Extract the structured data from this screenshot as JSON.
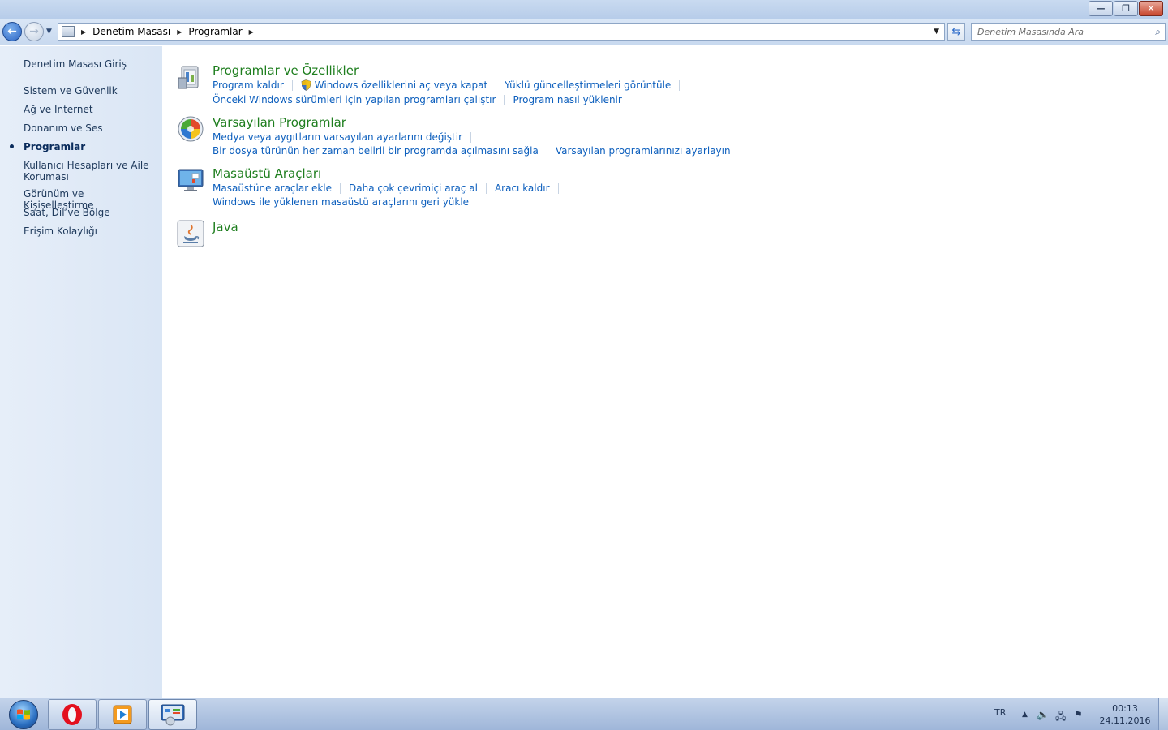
{
  "window": {
    "controls": {
      "minimize": "—",
      "restore": "❐",
      "close": "✕"
    }
  },
  "address": {
    "crumbs": [
      "Denetim Masası",
      "Programlar"
    ]
  },
  "search": {
    "placeholder": "Denetim Masasında Ara"
  },
  "sidebar": {
    "items": [
      {
        "label": "Denetim Masası Giriş"
      },
      {
        "label": "Sistem ve Güvenlik"
      },
      {
        "label": "Ağ ve Internet"
      },
      {
        "label": "Donanım ve Ses"
      },
      {
        "label": "Programlar",
        "active": true
      },
      {
        "label": "Kullanıcı Hesapları ve Aile Koruması"
      },
      {
        "label": "Görünüm ve Kişiselleştirme"
      },
      {
        "label": "Saat, Dil ve Bölge"
      },
      {
        "label": "Erişim Kolaylığı"
      }
    ]
  },
  "categories": [
    {
      "title": "Programlar ve Özellikler",
      "icon": "programs-features-icon",
      "rows": [
        [
          "Program kaldır",
          "Windows özelliklerini aç veya kapat",
          "Yüklü güncelleştirmeleri görüntüle"
        ],
        [
          "Önceki Windows sürümleri için yapılan programları çalıştır",
          "Program nasıl yüklenir"
        ]
      ]
    },
    {
      "title": "Varsayılan Programlar",
      "icon": "default-programs-icon",
      "rows": [
        [
          "Medya veya aygıtların varsayılan ayarlarını değiştir"
        ],
        [
          "Bir dosya türünün her zaman belirli bir programda açılmasını sağla",
          "Varsayılan programlarınızı ayarlayın"
        ]
      ]
    },
    {
      "title": "Masaüstü Araçları",
      "icon": "desktop-gadgets-icon",
      "rows": [
        [
          "Masaüstüne araçlar ekle",
          "Daha çok çevrimiçi araç al",
          "Aracı kaldır"
        ],
        [
          "Windows ile yüklenen masaüstü araçlarını geri yükle"
        ]
      ]
    },
    {
      "title": "Java",
      "icon": "java-icon",
      "rows": []
    }
  ],
  "taskbar": {
    "language": "TR",
    "time": "00:13",
    "date": "24.11.2016"
  },
  "colors": {
    "link": "#0d5fbd",
    "category_title": "#1e7e1e",
    "sidebar_bg": "#e3ecf8",
    "taskbar": "#b3c6e3"
  }
}
